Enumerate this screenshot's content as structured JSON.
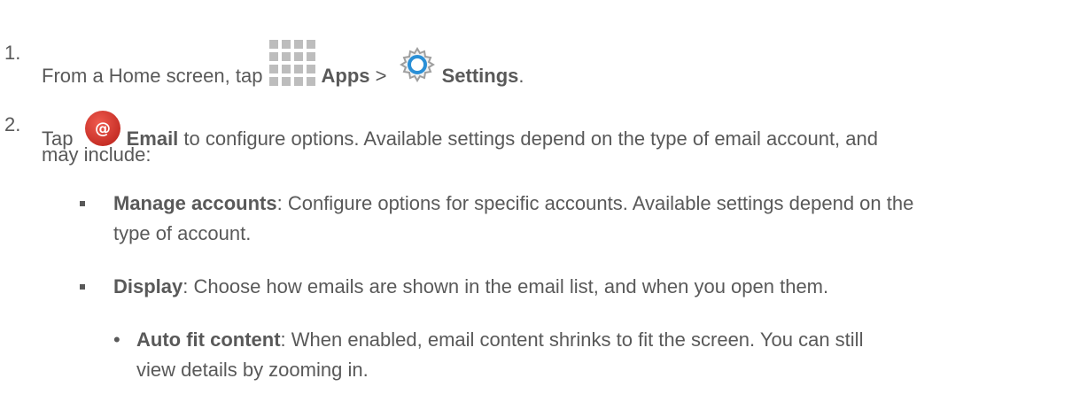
{
  "steps": [
    {
      "number": "1.",
      "pre": "From a Home screen, tap ",
      "apps_label": "Apps",
      "sep": " > ",
      "settings_label": "Settings",
      "post": "."
    },
    {
      "number": "2.",
      "pre": "Tap ",
      "email_label": "Email",
      "line1_rest": " to configure options. Available settings depend on the type of email account, and",
      "line2": "may include:"
    }
  ],
  "options": [
    {
      "label": "Manage accounts",
      "line1_rest": ": Configure options for specific accounts. Available settings depend on the",
      "line2": "type of account."
    },
    {
      "label": "Display",
      "line1_rest": ": Choose how emails are shown in the email list, and when you open them."
    }
  ],
  "sub_options": [
    {
      "bullet": "•",
      "label": "Auto fit content",
      "line1_rest": ": When enabled, email content shrinks to fit the screen. You can still",
      "line2": "view details by zooming in."
    }
  ],
  "icons": {
    "apps": "apps-grid-icon",
    "settings": "settings-gear-icon",
    "email": "email-at-icon"
  },
  "colors": {
    "text": "#595959",
    "email_icon_red": "#d6332a",
    "gear_blue": "#2a8fd6",
    "apps_gray": "#bdbdbd"
  }
}
